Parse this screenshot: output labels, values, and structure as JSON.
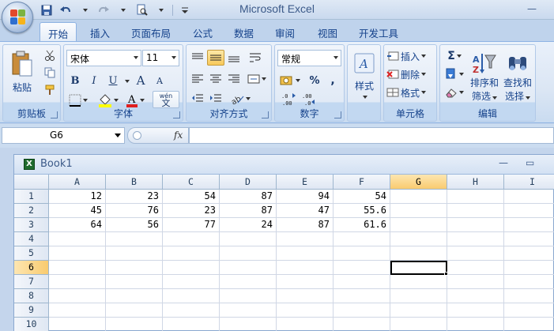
{
  "app": {
    "title": "Microsoft Excel"
  },
  "tabs": [
    "开始",
    "插入",
    "页面布局",
    "公式",
    "数据",
    "审阅",
    "视图",
    "开发工具"
  ],
  "ribbon": {
    "clipboard": {
      "label": "剪贴板",
      "paste": "粘贴"
    },
    "font": {
      "label": "字体",
      "name": "宋体",
      "size": "11",
      "bold": "B",
      "italic": "I",
      "underline": "U",
      "grow": "A",
      "shrink": "A",
      "wen": "wén",
      "wen_char": "文"
    },
    "alignment": {
      "label": "对齐方式"
    },
    "number": {
      "label": "数字",
      "format": "常规",
      "percent": "%",
      "comma": ","
    },
    "styles": {
      "label": "样式"
    },
    "cells": {
      "label": "单元格",
      "insert": "插入",
      "delete": "删除",
      "format": "格式"
    },
    "editing": {
      "label": "编辑",
      "sigma": "Σ",
      "sort": "排序和",
      "sort2": "筛选",
      "find": "查找和",
      "find2": "选择"
    }
  },
  "formula_bar": {
    "name_box": "G6",
    "fx": "fx",
    "value": ""
  },
  "workbook": {
    "title": "Book1",
    "columns": [
      "A",
      "B",
      "C",
      "D",
      "E",
      "F",
      "G",
      "H",
      "I"
    ],
    "rows": [
      "1",
      "2",
      "3",
      "4",
      "5",
      "6",
      "7",
      "8",
      "9",
      "10"
    ],
    "cells": [
      [
        "12",
        "23",
        "54",
        "87",
        "94",
        "54"
      ],
      [
        "45",
        "76",
        "23",
        "87",
        "47",
        "55.6"
      ],
      [
        "64",
        "56",
        "77",
        "24",
        "87",
        "61.6"
      ]
    ],
    "selected_col": "G",
    "selected_row": "6"
  }
}
